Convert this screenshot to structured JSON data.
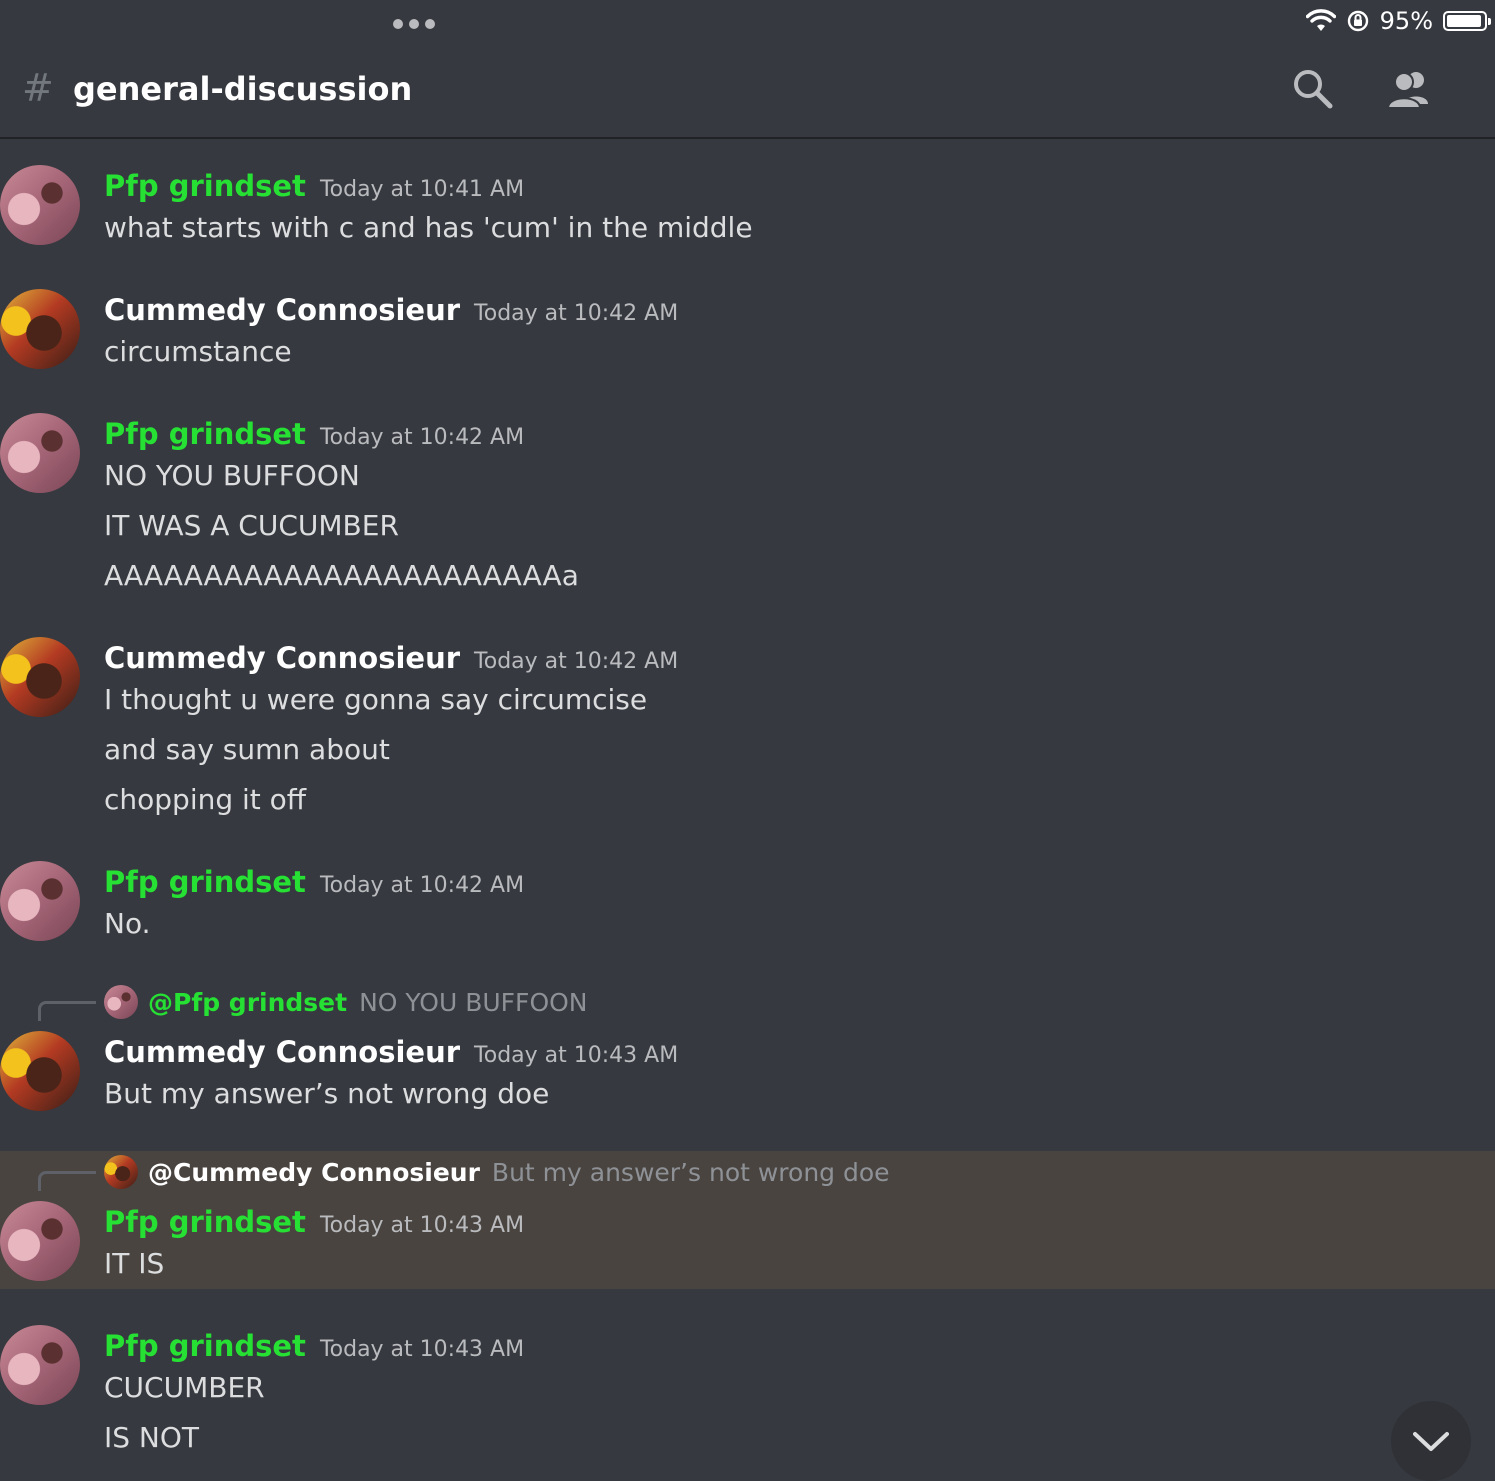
{
  "status_bar": {
    "battery_text": "95%",
    "battery_level": 0.95
  },
  "header": {
    "hash": "#",
    "channel": "general-discussion"
  },
  "messages": [
    {
      "author": "Pfp grindset",
      "time": "Today at 10:41 AM",
      "lines": [
        "what starts with c and has 'cum' in the middle"
      ]
    },
    {
      "author": "Cummedy Connosieur",
      "time": "Today at 10:42 AM",
      "lines": [
        "circumstance"
      ]
    },
    {
      "author": "Pfp grindset",
      "time": "Today at 10:42 AM",
      "lines": [
        "NO YOU BUFFOON",
        "IT WAS A CUCUMBER",
        "AAAAAAAAAAAAAAAAAAAAAAAa"
      ]
    },
    {
      "author": "Cummedy Connosieur",
      "time": "Today at 10:42 AM",
      "lines": [
        "I thought u were gonna say circumcise",
        "and say sumn about",
        "chopping it off"
      ]
    },
    {
      "author": "Pfp grindset",
      "time": "Today at 10:42 AM",
      "lines": [
        "No."
      ]
    },
    {
      "reply": {
        "author": "@Pfp grindset",
        "text": "NO YOU BUFFOON"
      },
      "author": "Cummedy Connosieur",
      "time": "Today at 10:43 AM",
      "lines": [
        "But my answer’s not wrong doe"
      ]
    },
    {
      "reply": {
        "author": "@Cummedy Connosieur",
        "text": "But my answer’s not wrong doe"
      },
      "author": "Pfp grindset",
      "time": "Today at 10:43 AM",
      "lines": [
        "IT IS"
      ]
    },
    {
      "author": "Pfp grindset",
      "time": "Today at 10:43 AM",
      "lines": [
        "CUCUMBER",
        "IS NOT"
      ]
    }
  ],
  "colors": {
    "background": "#36393f",
    "green_name": "#26e034",
    "highlight": "#4a4440"
  }
}
